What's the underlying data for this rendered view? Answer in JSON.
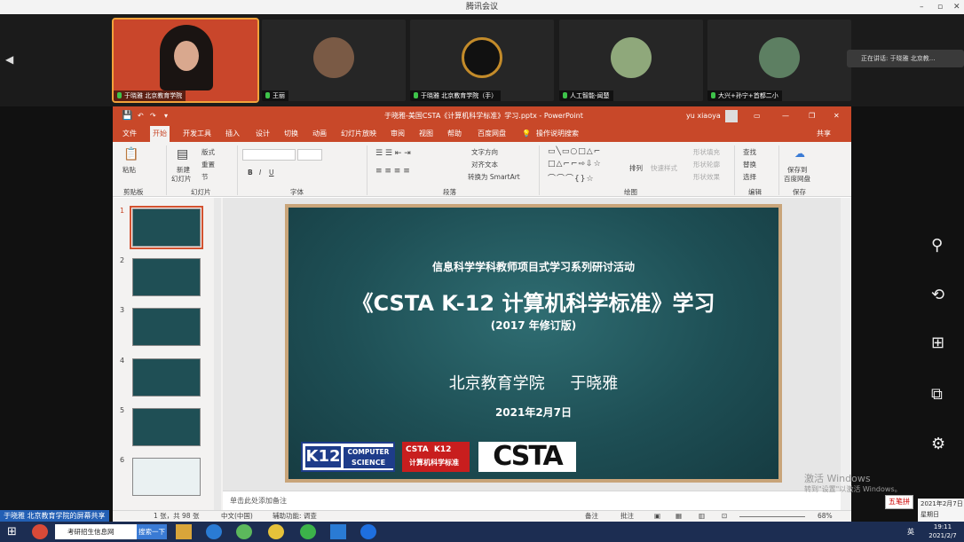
{
  "meeting": {
    "title": "腾讯会议",
    "participants": [
      {
        "name": "于晓雅 北京教育学院",
        "color": "#c9462b"
      },
      {
        "name": "王丽",
        "color": "#7a5a45"
      },
      {
        "name": "于晓雅 北京教育学院（手）",
        "color": "#c38b2a"
      },
      {
        "name": "人工智能-闻楚",
        "color": "#8fa87b"
      },
      {
        "name": "大兴+孙宁+首都二小",
        "color": "#5d7f62"
      }
    ],
    "speaking": "正在讲话: 于晓雅 北京教...",
    "screen_share": "于晓雅 北京教育学院的屏幕共享"
  },
  "ppt": {
    "title": "于晓雅-美国CSTA《计算机科学标准》学习.pptx - PowerPoint",
    "user": "yu xiaoya",
    "tabs": [
      "文件",
      "开始",
      "开发工具",
      "插入",
      "设计",
      "切换",
      "动画",
      "幻灯片放映",
      "审阅",
      "视图",
      "帮助",
      "百度网盘",
      "操作说明搜索"
    ],
    "share": "共享",
    "ribbon": {
      "paste": "粘贴",
      "clipboard": "剪贴板",
      "new_slide_1": "新建",
      "new_slide_2": "幻灯片",
      "layout": "版式",
      "reset": "重置",
      "section": "节",
      "slides": "幻灯片",
      "font": "字体",
      "text_direction": "文字方向",
      "align_text": "对齐文本",
      "smartart": "转换为 SmartArt",
      "paragraph": "段落",
      "arrange": "排列",
      "quick_styles": "快速样式",
      "shape_fill": "形状填充",
      "shape_outline": "形状轮廓",
      "shape_effects": "形状效果",
      "drawing": "绘图",
      "find": "查找",
      "replace": "替换",
      "select": "选择",
      "editing": "编辑",
      "save_1": "保存到",
      "save_2": "百度网盘",
      "save_group": "保存"
    },
    "thumbnails": [
      "1",
      "2",
      "3",
      "4",
      "5",
      "6"
    ],
    "slide": {
      "subtitle": "信息科学学科教师项目式学习系列研讨活动",
      "title": "《CSTA K-12 计算机科学标准》学习",
      "edition": "(2017 年修订版)",
      "author": "北京教育学院     于晓雅",
      "date": "2021年2月7日",
      "logo_k12": "K12",
      "logo_cs_1": "COMPUTER",
      "logo_cs_2": "SCIENCE",
      "logo_csta_1": "CSTA  K12",
      "logo_csta_2": "计算机科学标准",
      "logo_csta": "CSTA"
    },
    "notes_placeholder": "单击此处添加备注",
    "status": {
      "slide_count": "1 张，共 98 张",
      "language": "中文(中国)",
      "accessibility": "辅助功能: 调查",
      "notes": "备注",
      "comments": "批注",
      "zoom": "68%"
    }
  },
  "windows": {
    "activate_1": "激活 Windows",
    "activate_2": "转到\"设置\"以激活 Windows。",
    "search_placeholder": "考研招生信息网",
    "search_button": "搜索一下",
    "ime": "五笔拼",
    "clock_time": "19:11",
    "clock_date": "2021/2/7",
    "popup_date": "2021年2月7日",
    "popup_weekday": "星期日",
    "lang": "英"
  }
}
